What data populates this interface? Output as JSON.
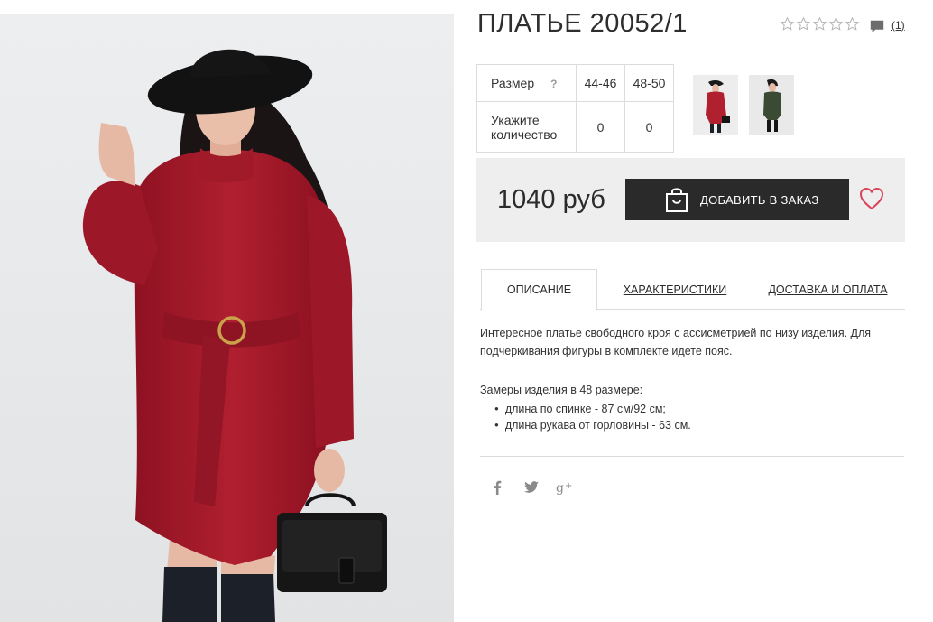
{
  "product": {
    "title": "ПЛАТЬЕ 20052/1",
    "rating_stars": 0,
    "rating_max": 5,
    "reviews_count": "(1)"
  },
  "sizes": {
    "row_size_label": "Размер",
    "help_mark": "?",
    "row_qty_label": "Укажите количество",
    "columns": [
      {
        "size": "44-46",
        "qty": "0"
      },
      {
        "size": "48-50",
        "qty": "0"
      }
    ]
  },
  "thumbs": [
    {
      "name": "thumb-red-dress",
      "color": "#b0202e"
    },
    {
      "name": "thumb-green-dress",
      "color": "#3b4a32"
    }
  ],
  "buy": {
    "price": "1040 руб",
    "add_label": "ДОБАВИТЬ В ЗАКАЗ"
  },
  "tabs": [
    {
      "label": "ОПИСАНИЕ",
      "active": true
    },
    {
      "label": "ХАРАКТЕРИСТИКИ",
      "active": false
    },
    {
      "label": "ДОСТАВКА И ОПЛАТА",
      "active": false
    }
  ],
  "description": {
    "text": "Интересное платье свободного кроя с ассисметрией по низу изделия. Для подчеркивания фигуры в комплекте идете пояс.",
    "measure_title": "Замеры изделия в 48 размере:",
    "measures": [
      "длина по спинке - 87 см/92 см;",
      "длина рукава от горловины - 63 см."
    ]
  },
  "social": [
    "facebook-icon",
    "twitter-icon",
    "google-plus-icon"
  ],
  "colors": {
    "dress": "#a3192a",
    "button": "#2a2a2a",
    "heart": "#d9445a",
    "buybox": "#eeeeee"
  }
}
